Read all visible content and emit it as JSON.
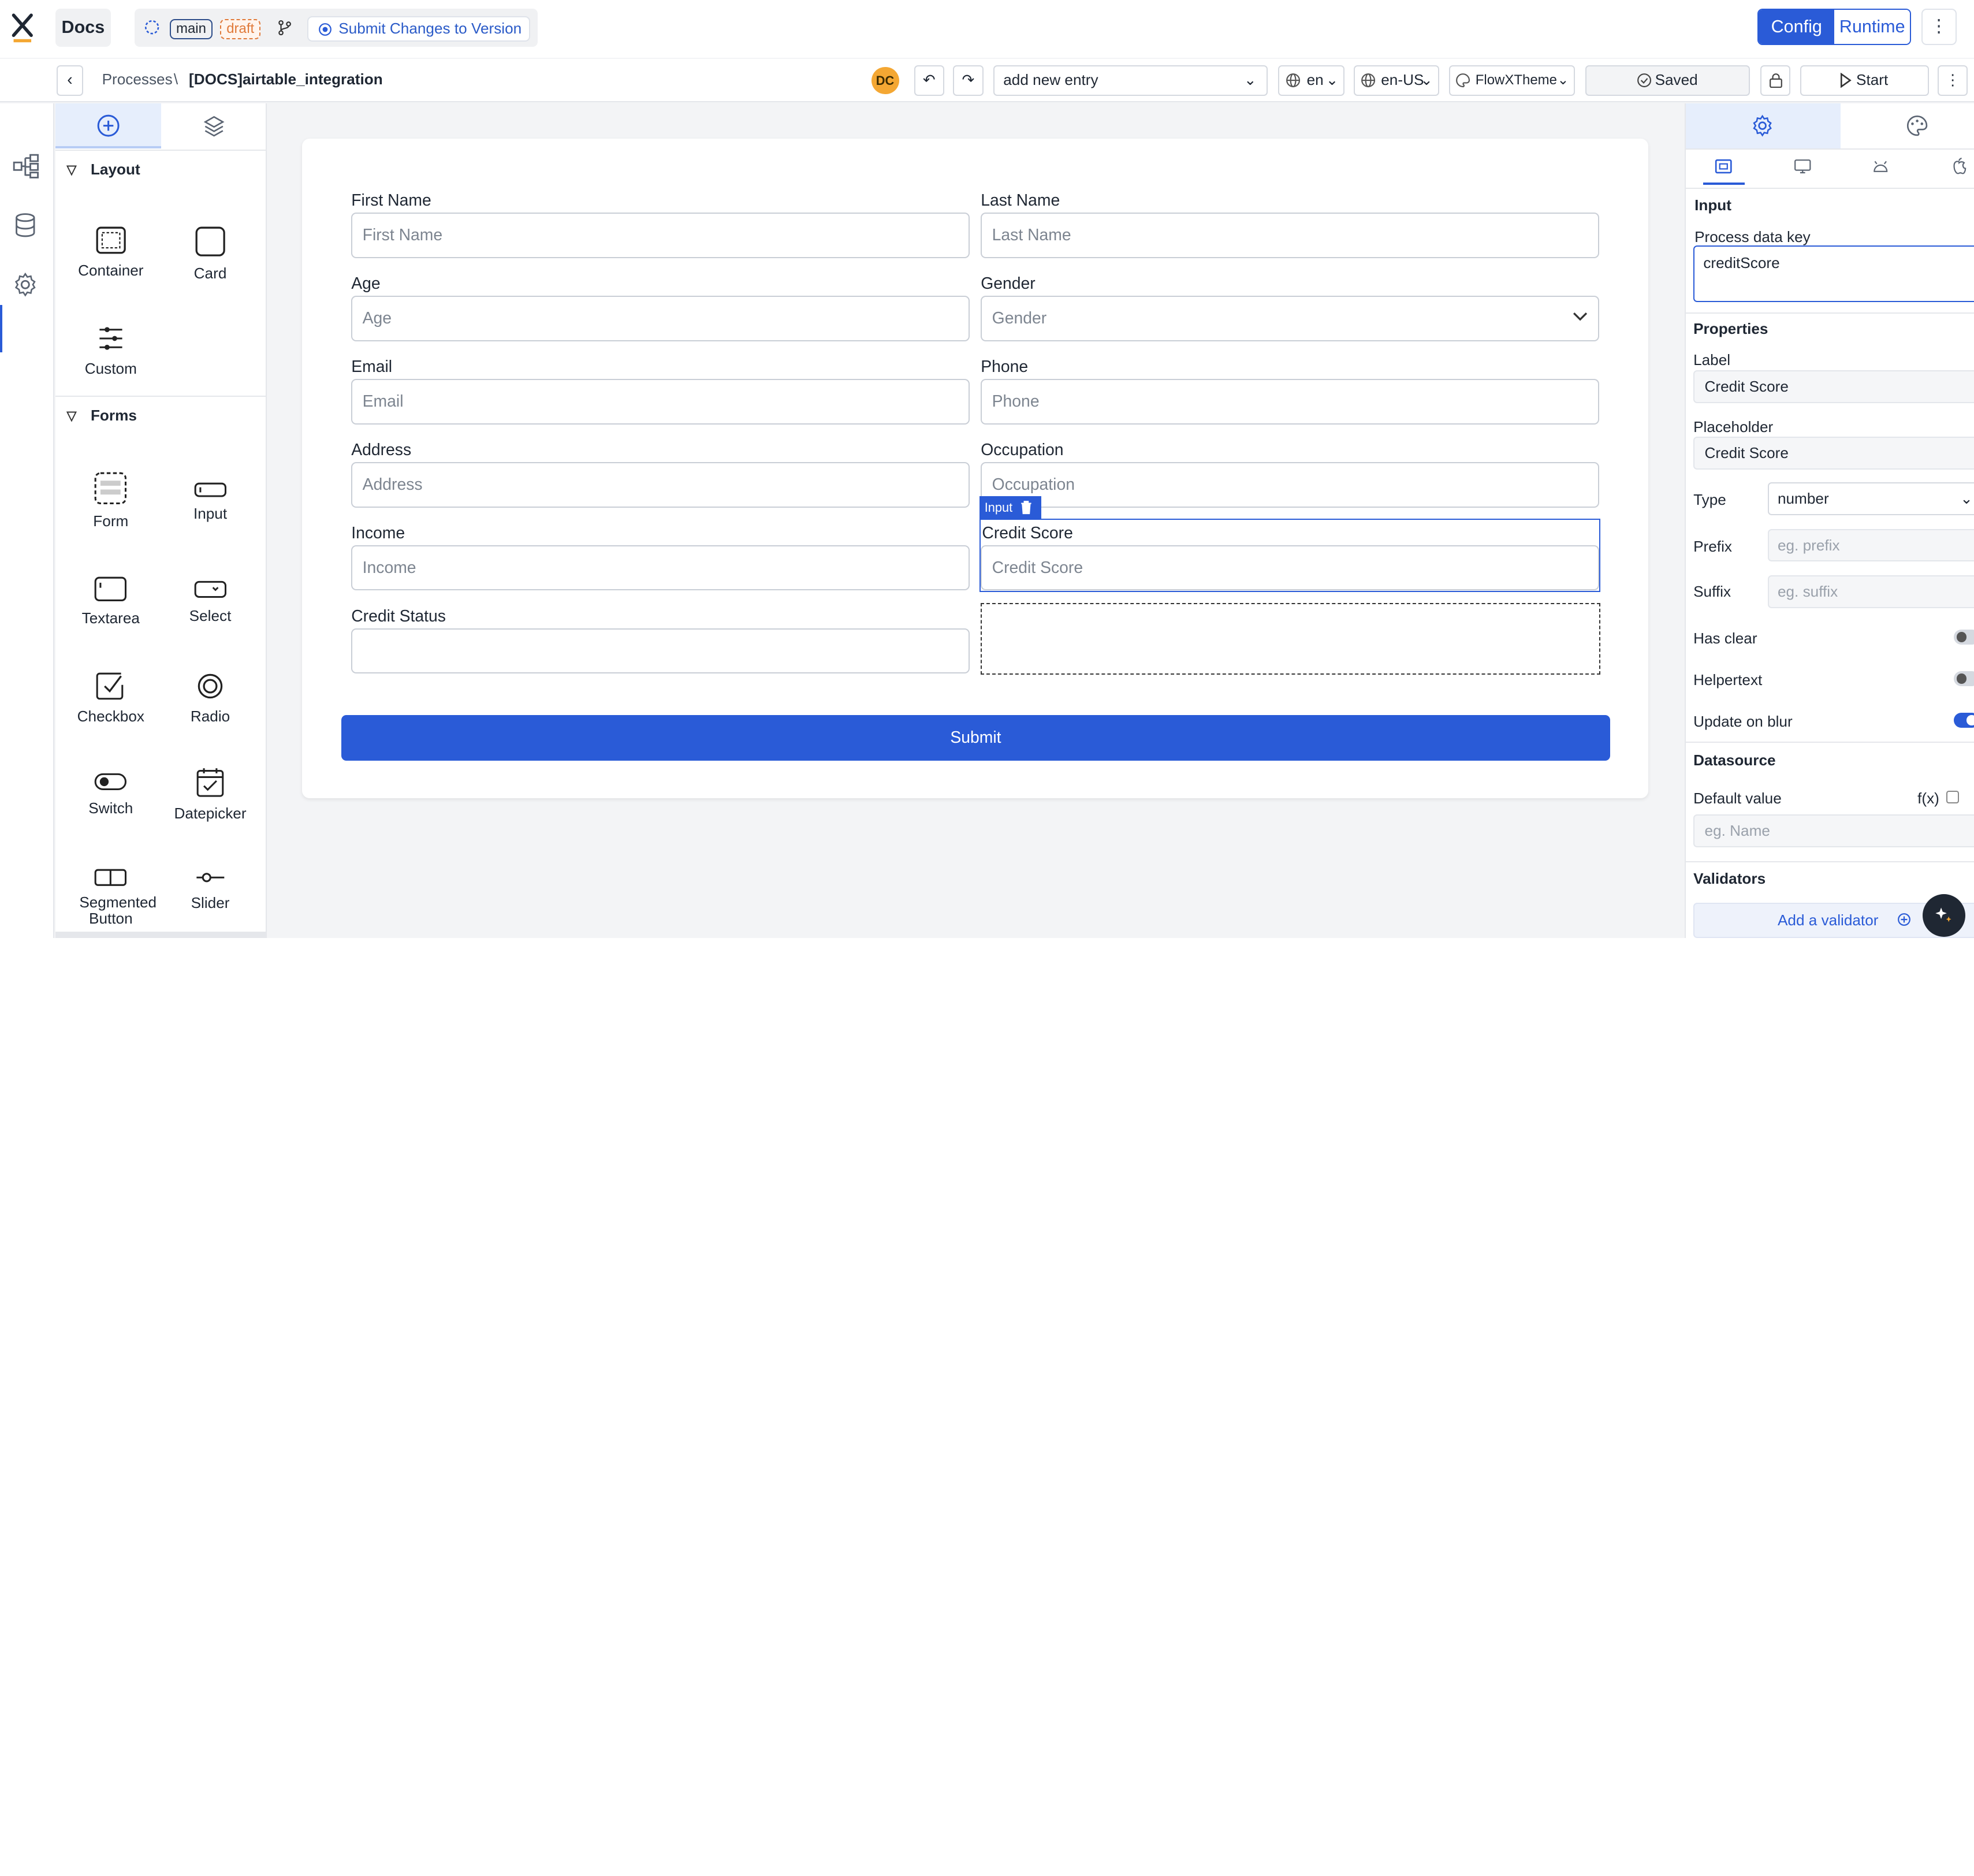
{
  "topbar": {
    "app_tab": "Docs",
    "branch": "main",
    "status": "draft",
    "submit_changes": "Submit Changes to Version",
    "mode_config": "Config",
    "mode_runtime": "Runtime",
    "more": "⋮"
  },
  "subbar": {
    "breadcrumb_root": "Processes",
    "breadcrumb_sep": "\\",
    "breadcrumb_current": "[DOCS]airtable_integration",
    "avatar": "DC",
    "entry_select": "add new entry",
    "lang": "en",
    "locale": "en-US",
    "theme": "FlowXTheme",
    "saved": "Saved",
    "start": "Start",
    "more": "⋮"
  },
  "components": {
    "layout_section": "Layout",
    "layout_items": [
      "Container",
      "Card",
      "Custom"
    ],
    "forms_section": "Forms",
    "form_items": [
      "Form",
      "Input",
      "Textarea",
      "Select",
      "Checkbox",
      "Radio",
      "Switch",
      "Datepicker",
      "Segmented Button",
      "Slider"
    ]
  },
  "form": {
    "fields": [
      {
        "label": "First Name",
        "placeholder": "First Name"
      },
      {
        "label": "Last Name",
        "placeholder": "Last Name"
      },
      {
        "label": "Age",
        "placeholder": "Age"
      },
      {
        "label": "Gender",
        "placeholder": "Gender"
      },
      {
        "label": "Email",
        "placeholder": "Email"
      },
      {
        "label": "Phone",
        "placeholder": "Phone"
      },
      {
        "label": "Address",
        "placeholder": "Address"
      },
      {
        "label": "Occupation",
        "placeholder": "Occupation"
      },
      {
        "label": "Income",
        "placeholder": "Income"
      },
      {
        "label": "Credit Score",
        "placeholder": "Credit Score"
      },
      {
        "label": "Credit Status",
        "placeholder": ""
      }
    ],
    "selected_tag": "Input",
    "submit": "Submit"
  },
  "properties": {
    "input_section": "Input",
    "process_key_label": "Process data key",
    "process_key_value": "creditScore",
    "properties_section": "Properties",
    "label_label": "Label",
    "label_value": "Credit Score",
    "placeholder_label": "Placeholder",
    "placeholder_value": "Credit Score",
    "type_label": "Type",
    "type_value": "number",
    "prefix_label": "Prefix",
    "prefix_placeholder": "eg. prefix",
    "suffix_label": "Suffix",
    "suffix_placeholder": "eg. suffix",
    "has_clear_label": "Has clear",
    "helpertext_label": "Helpertext",
    "update_blur_label": "Update on blur",
    "datasource_section": "Datasource",
    "default_value_label": "Default value",
    "fx_label": "f(x)",
    "default_value_placeholder": "eg. Name",
    "validators_section": "Validators",
    "add_validator": "Add a validator"
  },
  "colors": {
    "accent": "#2a5bd7",
    "draft": "#e07a3a",
    "avatar": "#f4a733"
  }
}
